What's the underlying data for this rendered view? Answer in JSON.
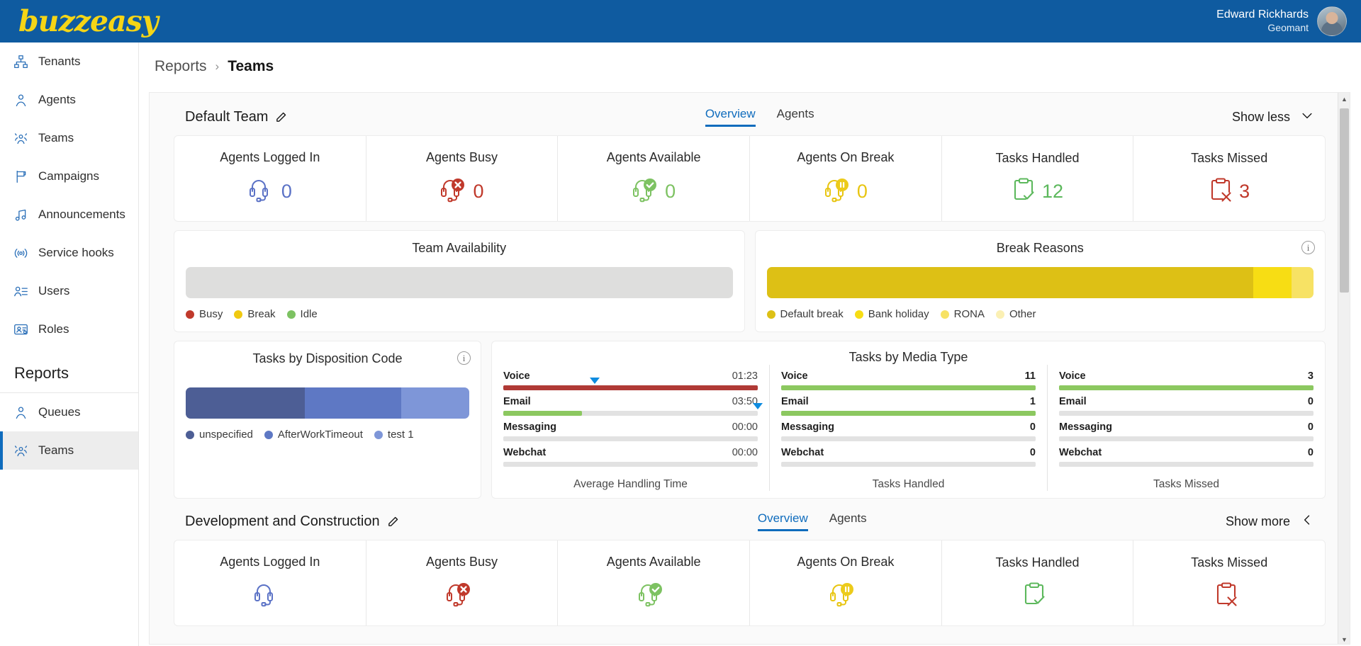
{
  "app": {
    "logo_text": "buzzeasy",
    "brand_blue": "#0f5ba0",
    "brand_yellow": "#f5d516"
  },
  "user": {
    "name": "Edward Rickhards",
    "company": "Geomant"
  },
  "breadcrumb": {
    "root": "Reports",
    "separator": "›",
    "current": "Teams"
  },
  "sidebar": {
    "items": [
      {
        "label": "Tenants",
        "icon": "org-chart-icon"
      },
      {
        "label": "Agents",
        "icon": "agent-icon"
      },
      {
        "label": "Teams",
        "icon": "teams-icon"
      },
      {
        "label": "Campaigns",
        "icon": "flag-icon"
      },
      {
        "label": "Announcements",
        "icon": "music-note-icon"
      },
      {
        "label": "Service hooks",
        "icon": "broadcast-icon"
      },
      {
        "label": "Users",
        "icon": "user-list-icon"
      },
      {
        "label": "Roles",
        "icon": "roles-icon"
      }
    ],
    "section_label": "Reports",
    "report_items": [
      {
        "label": "Queues",
        "icon": "queue-icon",
        "selected": false
      },
      {
        "label": "Teams",
        "icon": "teams-icon",
        "selected": true
      }
    ]
  },
  "teams": [
    {
      "name": "Default Team",
      "tabs": [
        {
          "label": "Overview",
          "active": true
        },
        {
          "label": "Agents",
          "active": false
        }
      ],
      "toggle_label": "Show less",
      "expanded": true,
      "kpis": [
        {
          "label": "Agents Logged In",
          "value": "0",
          "icon": "headset-icon",
          "color": "#5b72c6"
        },
        {
          "label": "Agents Busy",
          "value": "0",
          "icon": "headset-busy-icon",
          "color": "#c0392b"
        },
        {
          "label": "Agents Available",
          "value": "0",
          "icon": "headset-available-icon",
          "color": "#7dc262"
        },
        {
          "label": "Agents On Break",
          "value": "0",
          "icon": "headset-break-icon",
          "color": "#e8c511"
        },
        {
          "label": "Tasks Handled",
          "value": "12",
          "icon": "clipboard-check-icon",
          "color": "#5cb85c"
        },
        {
          "label": "Tasks Missed",
          "value": "3",
          "icon": "clipboard-x-icon",
          "color": "#c0392b"
        }
      ],
      "team_availability": {
        "title": "Team Availability",
        "empty": true,
        "legend": [
          {
            "label": "Busy",
            "color": "#c0392b"
          },
          {
            "label": "Break",
            "color": "#f0c911"
          },
          {
            "label": "Idle",
            "color": "#7dc262"
          }
        ]
      },
      "break_reasons": {
        "title": "Break Reasons",
        "info": "i",
        "legend": [
          {
            "label": "Default break",
            "color": "#ddc015"
          },
          {
            "label": "Bank holiday",
            "color": "#f7dd14"
          },
          {
            "label": "RONA",
            "color": "#f7e264"
          },
          {
            "label": "Other",
            "color": "#fbf0b4"
          }
        ],
        "segments": [
          {
            "label": "Default break",
            "percent": 89,
            "color": "#ddc015"
          },
          {
            "label": "Bank holiday",
            "percent": 7,
            "color": "#f7dd14"
          },
          {
            "label": "RONA",
            "percent": 4,
            "color": "#f7e264"
          }
        ]
      },
      "disposition": {
        "title": "Tasks by Disposition Code",
        "info": "i",
        "segments": [
          {
            "label": "unspecified",
            "percent": 42,
            "color": "#4d5e95"
          },
          {
            "label": "AfterWorkTimeout",
            "percent": 34,
            "color": "#5e78c4"
          },
          {
            "label": "test 1",
            "percent": 24,
            "color": "#7e96d8"
          }
        ],
        "legend": [
          {
            "label": "unspecified",
            "color": "#4d5e95"
          },
          {
            "label": "AfterWorkTimeout",
            "color": "#5e78c4"
          },
          {
            "label": "test 1",
            "color": "#7e96d8"
          }
        ]
      },
      "media": {
        "title": "Tasks by Media Type",
        "columns": [
          {
            "caption": "Average Handling Time",
            "rows": [
              {
                "label": "Voice",
                "value": "01:23",
                "fill_percent": 100,
                "color": "#b03a36",
                "marker_percent": 36
              },
              {
                "label": "Email",
                "value": "03:50",
                "fill_percent": 31,
                "color": "#8cc860",
                "marker_percent": 100
              },
              {
                "label": "Messaging",
                "value": "00:00",
                "fill_percent": 0,
                "color": "#8cc860",
                "marker_percent": -1
              },
              {
                "label": "Webchat",
                "value": "00:00",
                "fill_percent": 0,
                "color": "#8cc860",
                "marker_percent": -1
              }
            ]
          },
          {
            "caption": "Tasks Handled",
            "rows": [
              {
                "label": "Voice",
                "value": "11",
                "fill_percent": 100,
                "color": "#8cc860",
                "marker_percent": -1
              },
              {
                "label": "Email",
                "value": "1",
                "fill_percent": 100,
                "color": "#8cc860",
                "marker_percent": -1
              },
              {
                "label": "Messaging",
                "value": "0",
                "fill_percent": 0,
                "color": "#8cc860",
                "marker_percent": -1
              },
              {
                "label": "Webchat",
                "value": "0",
                "fill_percent": 0,
                "color": "#8cc860",
                "marker_percent": -1
              }
            ]
          },
          {
            "caption": "Tasks Missed",
            "rows": [
              {
                "label": "Voice",
                "value": "3",
                "fill_percent": 100,
                "color": "#8cc860",
                "marker_percent": -1
              },
              {
                "label": "Email",
                "value": "0",
                "fill_percent": 0,
                "color": "#8cc860",
                "marker_percent": -1
              },
              {
                "label": "Messaging",
                "value": "0",
                "fill_percent": 0,
                "color": "#8cc860",
                "marker_percent": -1
              },
              {
                "label": "Webchat",
                "value": "0",
                "fill_percent": 0,
                "color": "#8cc860",
                "marker_percent": -1
              }
            ]
          }
        ]
      }
    },
    {
      "name": "Development and Construction",
      "tabs": [
        {
          "label": "Overview",
          "active": true
        },
        {
          "label": "Agents",
          "active": false
        }
      ],
      "toggle_label": "Show more",
      "expanded": false,
      "kpis": [
        {
          "label": "Agents Logged In",
          "value": "",
          "icon": "headset-icon",
          "color": "#5b72c6"
        },
        {
          "label": "Agents Busy",
          "value": "",
          "icon": "headset-busy-icon",
          "color": "#c0392b"
        },
        {
          "label": "Agents Available",
          "value": "",
          "icon": "headset-available-icon",
          "color": "#7dc262"
        },
        {
          "label": "Agents On Break",
          "value": "",
          "icon": "headset-break-icon",
          "color": "#e8c511"
        },
        {
          "label": "Tasks Handled",
          "value": "",
          "icon": "clipboard-check-icon",
          "color": "#5cb85c"
        },
        {
          "label": "Tasks Missed",
          "value": "",
          "icon": "clipboard-x-icon",
          "color": "#c0392b"
        }
      ]
    }
  ],
  "chart_data": [
    {
      "type": "bar",
      "title": "Break Reasons",
      "categories": [
        "Default break",
        "Bank holiday",
        "RONA",
        "Other"
      ],
      "values": [
        89,
        7,
        4,
        0
      ],
      "stacked": true,
      "ylabel": "",
      "xlabel": "",
      "legend_position": "bottom"
    },
    {
      "type": "bar",
      "title": "Tasks by Disposition Code",
      "categories": [
        "unspecified",
        "AfterWorkTimeout",
        "test 1"
      ],
      "values": [
        42,
        34,
        24
      ],
      "stacked": true,
      "legend_position": "bottom"
    },
    {
      "type": "bar",
      "title": "Tasks by Media Type",
      "categories": [
        "Voice",
        "Email",
        "Messaging",
        "Webchat"
      ],
      "series": [
        {
          "name": "Average Handling Time",
          "values": [
            "01:23",
            "03:50",
            "00:00",
            "00:00"
          ]
        },
        {
          "name": "Tasks Handled",
          "values": [
            11,
            1,
            0,
            0
          ]
        },
        {
          "name": "Tasks Missed",
          "values": [
            3,
            0,
            0,
            0
          ]
        }
      ],
      "legend_position": "bottom"
    },
    {
      "type": "bar",
      "title": "Team Availability",
      "categories": [
        "Busy",
        "Break",
        "Idle"
      ],
      "values": [
        0,
        0,
        0
      ],
      "stacked": true,
      "legend_position": "bottom"
    }
  ]
}
